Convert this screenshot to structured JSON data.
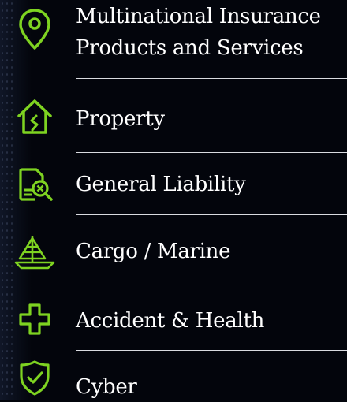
{
  "accent_color": "#7ed321",
  "items": [
    {
      "label_line1": "Multinational Insurance",
      "label_line2": "Products and Services",
      "icon": "location-pin-icon"
    },
    {
      "label": "Property",
      "icon": "house-icon"
    },
    {
      "label": "General Liability",
      "icon": "document-search-icon"
    },
    {
      "label": "Cargo / Marine",
      "icon": "sailboat-icon"
    },
    {
      "label": "Accident & Health",
      "icon": "medical-cross-icon"
    },
    {
      "label": "Cyber",
      "icon": "shield-check-icon"
    }
  ]
}
